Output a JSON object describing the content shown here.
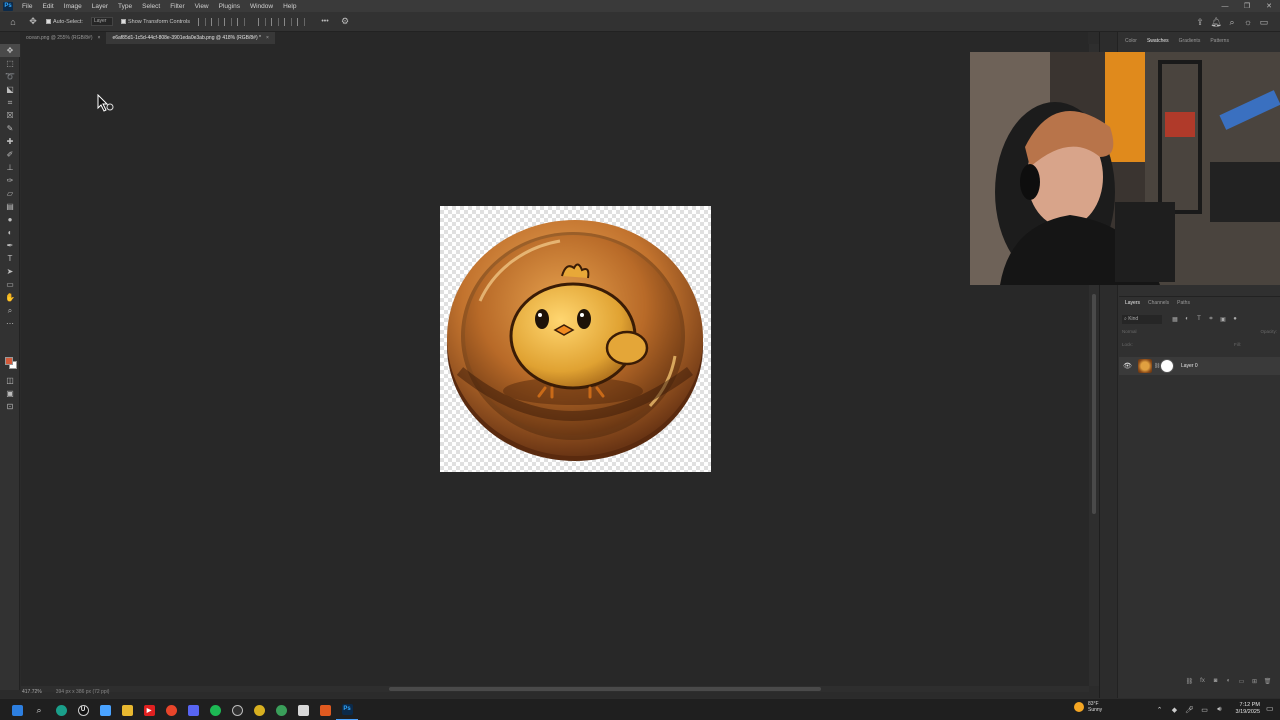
{
  "app": {
    "logo": "Ps",
    "menu": [
      "File",
      "Edit",
      "Image",
      "Layer",
      "Type",
      "Select",
      "Filter",
      "View",
      "Plugins",
      "Window",
      "Help"
    ],
    "window_controls": {
      "minimize": "—",
      "restore": "❐",
      "close": "✕"
    }
  },
  "options": {
    "home_icon": "home-icon",
    "move_icon": "move-icon",
    "auto_select_label": "Auto-Select:",
    "auto_select_target": "Layer",
    "show_transform_label": "Show Transform Controls",
    "more_label": "•••"
  },
  "tabs": [
    {
      "label": "ocean.png @ 255% (RGB/8#)",
      "close": "×"
    },
    {
      "label": "e6af85d1-1c5d-44cf-808e-3901eda0e3ab.png @ 418% (RGB/8#) *",
      "close": "×"
    }
  ],
  "status": {
    "zoom": "417.72%",
    "doc_size": "394 px x 386 px (72 ppi)"
  },
  "right_panel": {
    "tabs": [
      "Color",
      "Swatches",
      "Gradients",
      "Patterns"
    ],
    "active_tab": "Swatches"
  },
  "layers": {
    "tabs": [
      "Layers",
      "Channels",
      "Paths"
    ],
    "active_tab": "Layers",
    "filter_label": "Kind",
    "blend_mode": "Normal",
    "opacity_label": "Opacity:",
    "lock_label": "Lock:",
    "fill_label": "Fill:",
    "items": [
      {
        "name": "Layer 0",
        "visible": true
      }
    ]
  },
  "taskbar": {
    "weather_temp": "83°F",
    "weather_desc": "Sunny",
    "time": "7:12 PM",
    "date": "3/19/2025"
  },
  "colors": {
    "accent": "#31a8ff",
    "foreground_swatch": "#d35a3a",
    "background_swatch": "#ffffff",
    "canvas_bg": "#282828"
  }
}
